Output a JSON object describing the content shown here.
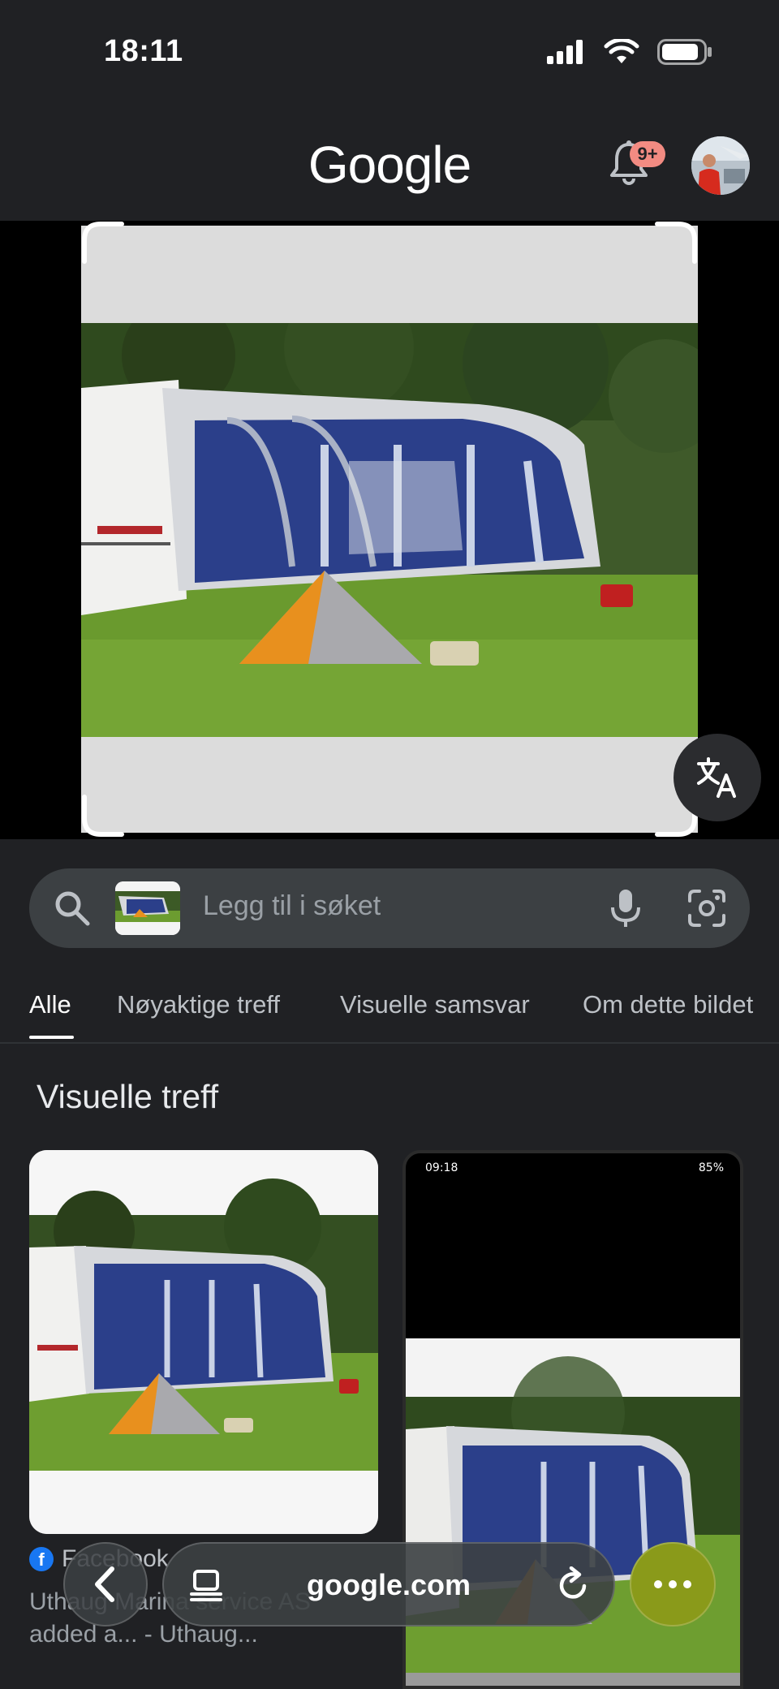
{
  "status_bar": {
    "time": "18:11"
  },
  "header": {
    "logo_text": "Google",
    "notification_badge": "9+"
  },
  "search": {
    "placeholder": "Legg til i søket"
  },
  "tabs": [
    {
      "label": "Alle",
      "active": true
    },
    {
      "label": "Nøyaktige treff",
      "active": false
    },
    {
      "label": "Visuelle samsvar",
      "active": false
    },
    {
      "label": "Om dette bildet",
      "active": false
    }
  ],
  "results": {
    "section_title": "Visuelle treff",
    "items": [
      {
        "source": "Facebook",
        "title": "Uthaug Marina service AS added a... - Uthaug..."
      },
      {
        "status_time": "09:18",
        "status_battery": "85%"
      }
    ]
  },
  "bottom_bar": {
    "url": "google.com"
  },
  "colors": {
    "background": "#202124",
    "pill": "#3c4043",
    "badge": "#f28b82",
    "more_button": "#8a9a1a"
  }
}
